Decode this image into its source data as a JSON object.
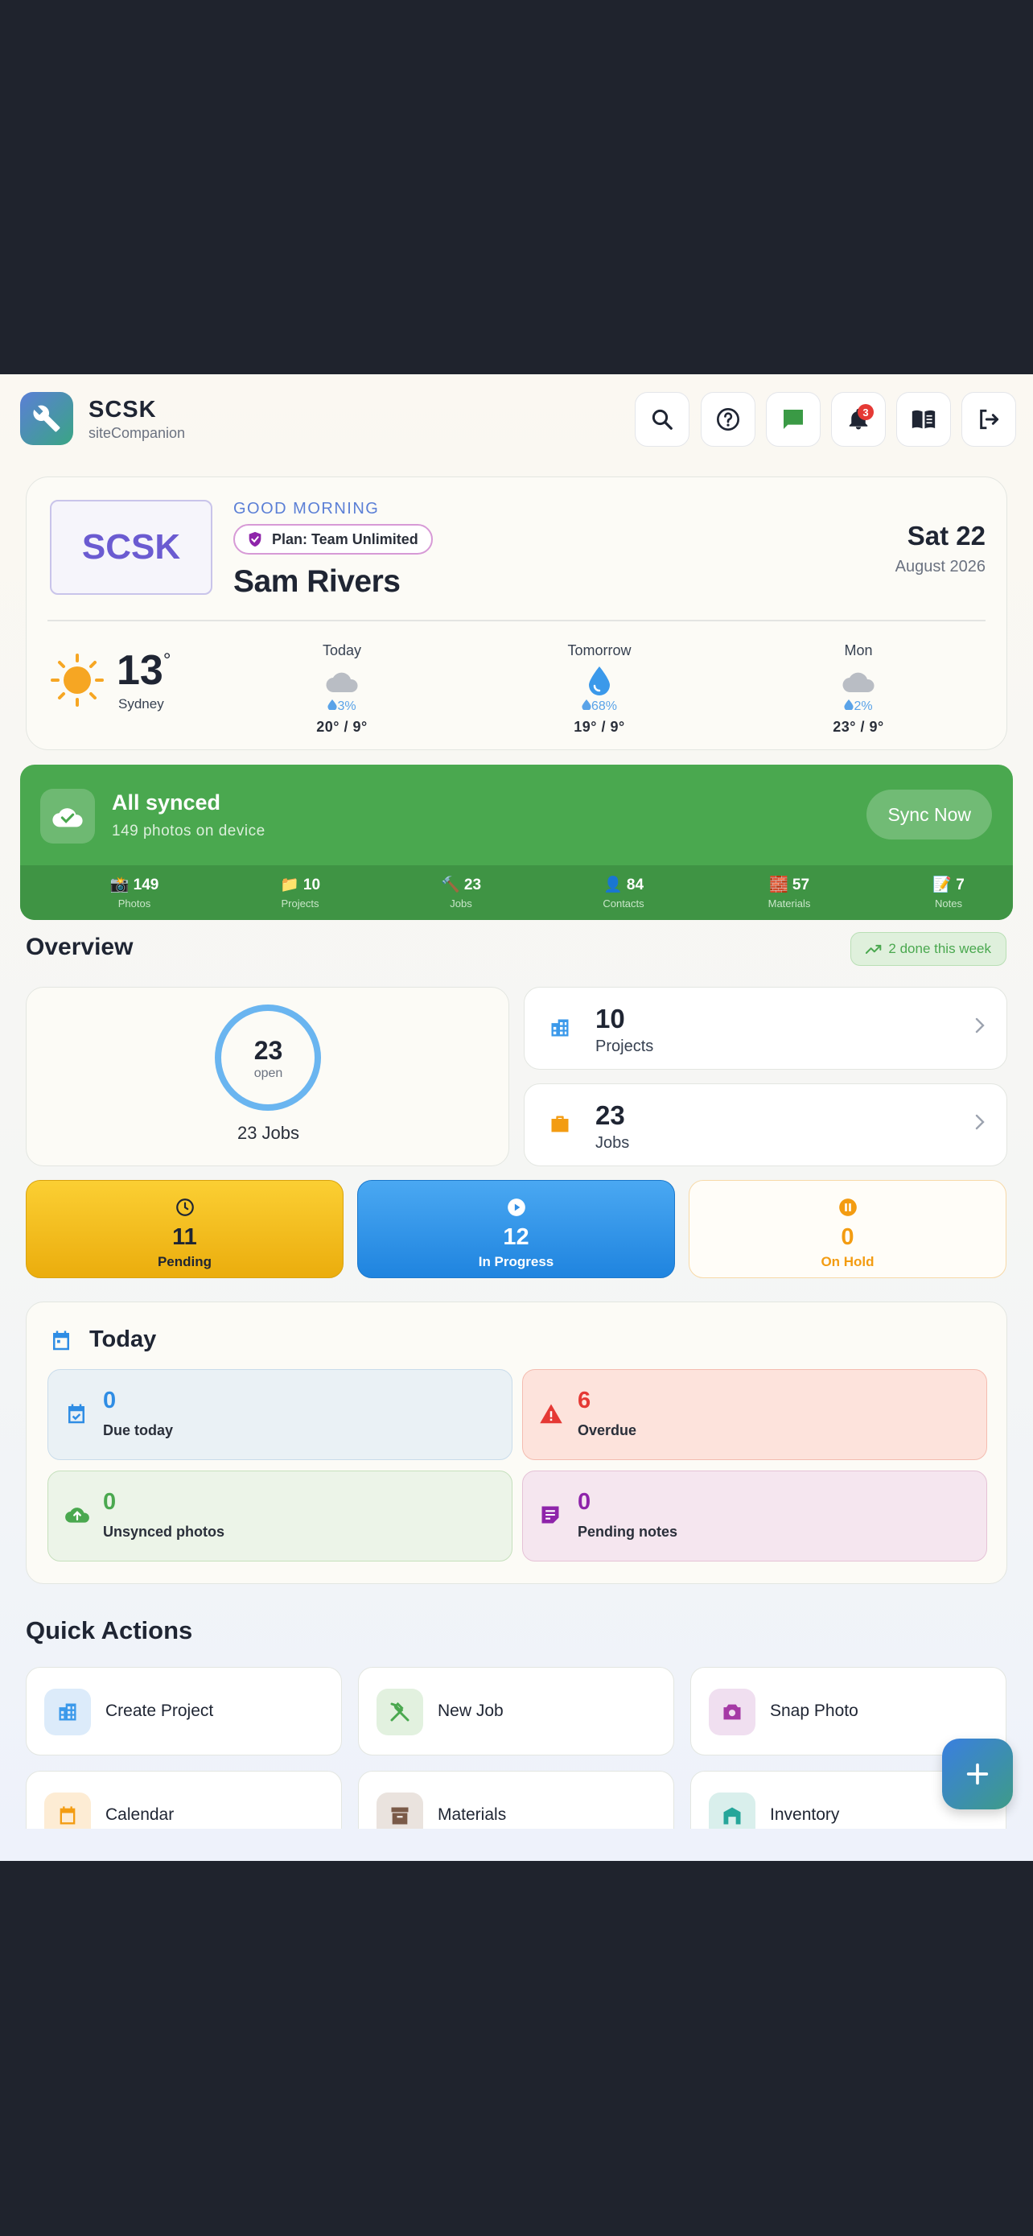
{
  "header": {
    "app_name": "SCSK",
    "app_sub": "siteCompanion",
    "notification_count": "3"
  },
  "greeting": {
    "company_logo_text": "SCSK",
    "salutation": "GOOD MORNING",
    "plan": "Plan: Team Unlimited",
    "user_name": "Sam Rivers",
    "date_main": "Sat 22",
    "date_sub": "August 2026"
  },
  "weather": {
    "current_temp": "13",
    "degree_symbol": "°",
    "city": "Sydney",
    "forecast": [
      {
        "day": "Today",
        "icon": "cloud-icon",
        "precip": "3%",
        "range": "20° / 9°"
      },
      {
        "day": "Tomorrow",
        "icon": "raindrop-icon",
        "precip": "68%",
        "range": "19° / 9°"
      },
      {
        "day": "Mon",
        "icon": "cloud-icon",
        "precip": "2%",
        "range": "23° / 9°"
      }
    ]
  },
  "sync": {
    "title": "All synced",
    "subtitle": "149 photos on device",
    "button": "Sync Now",
    "stats": [
      {
        "icon": "📸",
        "value": "149",
        "label": "Photos"
      },
      {
        "icon": "📁",
        "value": "10",
        "label": "Projects"
      },
      {
        "icon": "🔨",
        "value": "23",
        "label": "Jobs"
      },
      {
        "icon": "👤",
        "value": "84",
        "label": "Contacts"
      },
      {
        "icon": "🧱",
        "value": "57",
        "label": "Materials"
      },
      {
        "icon": "📝",
        "value": "7",
        "label": "Notes"
      }
    ]
  },
  "overview": {
    "title": "Overview",
    "done_pill": "2 done this week",
    "ring_value": "23",
    "ring_label": "open",
    "jobs_caption": "23 Jobs",
    "projects": {
      "value": "10",
      "label": "Projects"
    },
    "jobs": {
      "value": "23",
      "label": "Jobs"
    },
    "statuses": [
      {
        "value": "11",
        "label": "Pending"
      },
      {
        "value": "12",
        "label": "In Progress"
      },
      {
        "value": "0",
        "label": "On Hold"
      }
    ]
  },
  "today": {
    "title": "Today",
    "cells": [
      {
        "value": "0",
        "label": "Due today"
      },
      {
        "value": "6",
        "label": "Overdue"
      },
      {
        "value": "0",
        "label": "Unsynced photos"
      },
      {
        "value": "0",
        "label": "Pending notes"
      }
    ]
  },
  "quick_actions": {
    "title": "Quick Actions",
    "items": [
      {
        "label": "Create Project"
      },
      {
        "label": "New Job"
      },
      {
        "label": "Snap Photo"
      },
      {
        "label": "Calendar"
      },
      {
        "label": "Materials"
      },
      {
        "label": "Inventory"
      }
    ]
  },
  "colors": {
    "accent_green": "#4aa84f",
    "accent_blue": "#2f8de4",
    "pending_yellow": "#f6bd16",
    "overdue_red": "#e53935",
    "brand_purple": "#6b5bd1"
  }
}
